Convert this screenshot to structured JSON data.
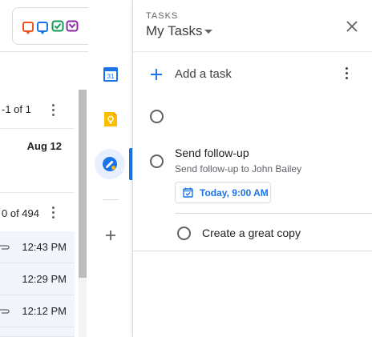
{
  "gmail_clip": {
    "pagination_1": "-1 of 1",
    "date_label": "Aug 12",
    "pagination_2": "0 of 494",
    "emails": [
      {
        "time": "12:43 PM"
      },
      {
        "time": "12:29 PM"
      },
      {
        "time": "12:12 PM"
      }
    ]
  },
  "app_logo": {
    "icons": [
      "chat-bubble-orange-icon",
      "chat-bubble-blue-icon",
      "check-green-icon",
      "check-purple-icon"
    ],
    "colors": [
      "#f4511e",
      "#1a73e8",
      "#0f9d58",
      "#8e24aa"
    ]
  },
  "side_rail": {
    "calendar_day": "31",
    "items": [
      "calendar-icon",
      "keep-icon",
      "tasks-icon",
      "add-icon"
    ]
  },
  "tasks_panel": {
    "overline": "TASKS",
    "list_name": "My Tasks",
    "add_task_label": "Add a task",
    "tasks": [
      {
        "title": "Send follow-up",
        "details": "Send follow-up to John Bailey",
        "due": "Today, 9:00 AM",
        "subtasks": [
          {
            "title": "Create a great copy"
          }
        ]
      }
    ]
  },
  "colors": {
    "accent": "#1a73e8",
    "active_rail_bg": "#e8f0fe",
    "keep_yellow": "#fbbc04"
  }
}
